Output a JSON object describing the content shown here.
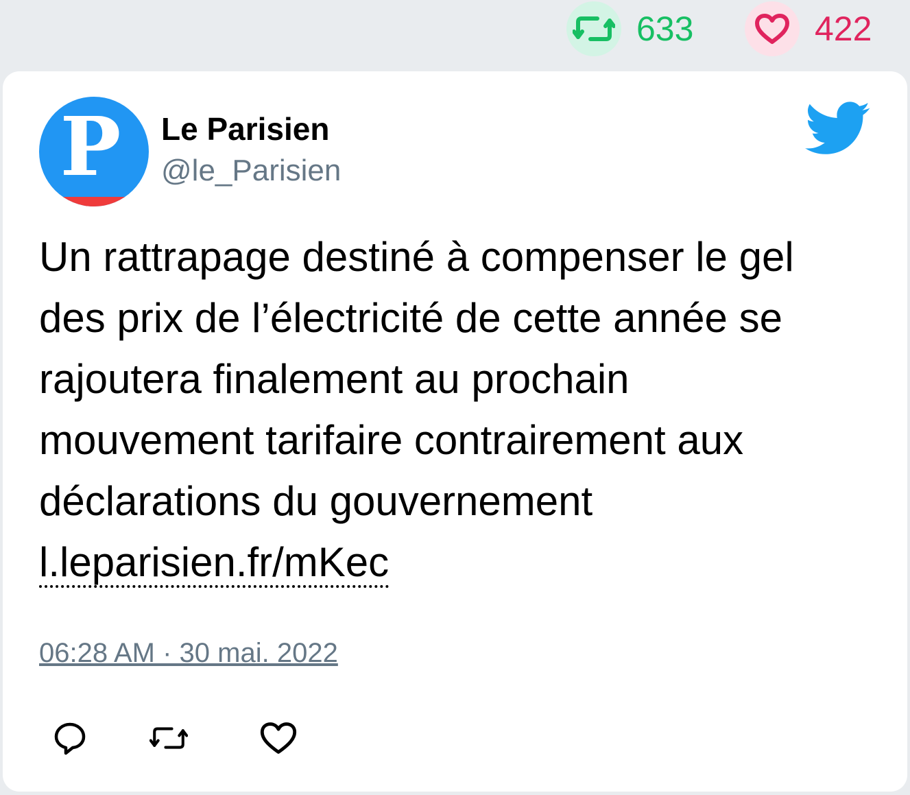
{
  "stats": {
    "retweets": "633",
    "likes": "422",
    "retweet_color": "#17bf63",
    "like_color": "#e0245e"
  },
  "author": {
    "name": "Le Parisien",
    "handle": "@le_Parisien",
    "avatar_letter": "P"
  },
  "tweet": {
    "text": "Un rattrapage destiné à compenser le gel des prix de l’électricité de cette année se rajoutera finalement au prochain mouvement tarifaire contrairement aux déclarations du gouvernement ",
    "link": "l.leparisien.fr/mKec",
    "timestamp": "06:28 AM · 30 mai. 2022"
  },
  "icons": [
    "retweet-icon",
    "heart-icon",
    "twitter-bird-icon",
    "reply-icon"
  ],
  "brand_color": "#1da1f2"
}
